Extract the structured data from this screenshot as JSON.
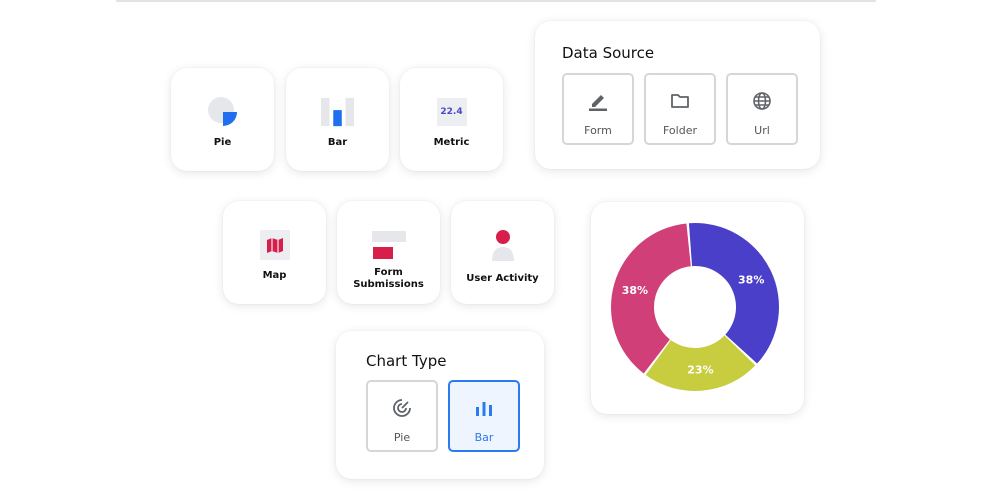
{
  "widgets_row1": [
    {
      "label": "Pie",
      "icon": "pie-chart-icon"
    },
    {
      "label": "Bar",
      "icon": "bar-chart-icon"
    },
    {
      "label": "Metric",
      "icon": "metric-icon",
      "value": "22.4"
    }
  ],
  "widgets_row2": [
    {
      "label": "Map",
      "icon": "map-icon"
    },
    {
      "label": "Form Submissions",
      "icon": "form-submissions-icon"
    },
    {
      "label": "User Activity",
      "icon": "user-activity-icon"
    }
  ],
  "data_source": {
    "title": "Data Source",
    "options": [
      {
        "label": "Form",
        "icon": "pencil-icon"
      },
      {
        "label": "Folder",
        "icon": "folder-icon"
      },
      {
        "label": "Url",
        "icon": "globe-icon"
      }
    ]
  },
  "chart_type": {
    "title": "Chart Type",
    "options": [
      {
        "label": "Pie",
        "icon": "radar-icon",
        "selected": false
      },
      {
        "label": "Bar",
        "icon": "bar-chart-icon",
        "selected": true
      }
    ]
  },
  "colors": {
    "accent": "#2b7bf0",
    "red": "#d81e4a",
    "metric": "#4a48c9"
  },
  "chart_data": {
    "type": "pie",
    "labels": [
      "38%",
      "23%",
      "38%"
    ],
    "values": [
      38,
      23,
      38
    ],
    "colors": [
      "#4a3fc9",
      "#c7cd3e",
      "#d13f78"
    ]
  }
}
